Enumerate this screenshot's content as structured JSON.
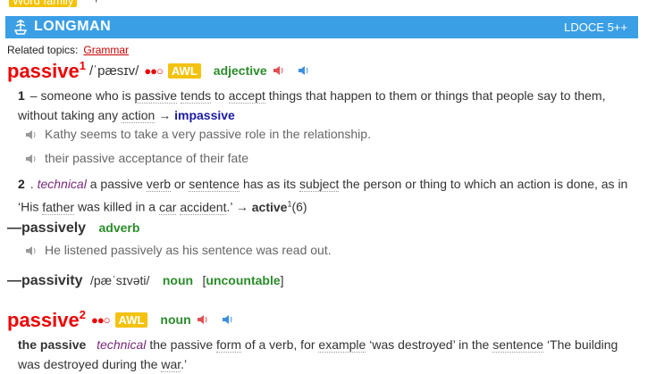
{
  "top": {
    "word_family": "Word family",
    "plus": "+"
  },
  "banner": {
    "brand": "LONGMAN",
    "edition": "LDOCE 5++"
  },
  "related": {
    "label": "Related topics:",
    "topic": "Grammar"
  },
  "entry1": {
    "headword": "passive",
    "homnum": "1",
    "pron": "/ˈpæsɪv/",
    "freq": "●●○",
    "awl": "AWL",
    "pos": "adjective",
    "sense1": {
      "num": "1",
      "sep": "–",
      "def_parts": [
        "someone who is",
        "passive",
        "tends",
        "to",
        "accept",
        "things that happen to them or things that people say to them, without taking any",
        "action",
        "→",
        "impassive"
      ],
      "examples": [
        "Kathy seems to take a very passive role in the relationship.",
        "their passive acceptance of their fate"
      ]
    },
    "sense2": {
      "num": "2",
      "dot": ".",
      "register": "technical",
      "text_a": "a passive",
      "verb": "verb",
      "or": "or",
      "sentence": "sentence",
      "has_as_its": "has as its",
      "subject": "subject",
      "rest": "the person or thing to which an action is done, as in ‘His",
      "father": "father",
      "was_killed": "was killed in a",
      "car": "car",
      "accident": "accident",
      "end": ".’",
      "arrow": "→",
      "xref": "active",
      "xref_sup": "1",
      "xref_num": "(6)"
    }
  },
  "runon1": {
    "dash": "—",
    "word": "passively",
    "pos": "adverb",
    "example": "He listened passively as his sentence was read out."
  },
  "runon2": {
    "dash": "—",
    "word": "passivity",
    "pron": "/pæˈsɪvəti/",
    "pos": "noun",
    "gram_open": "[",
    "gram": "uncountable",
    "gram_close": "]"
  },
  "entry2": {
    "headword": "passive",
    "homnum": "2",
    "freq": "●●○",
    "awl": "AWL",
    "pos": "noun",
    "sense": {
      "phrase": "the passive",
      "register": "technical",
      "text_a": "the passive",
      "form": "form",
      "of_a_verb": "of a verb, for",
      "example": "example",
      "quote": "‘was destroyed’ in the",
      "sentence": "sentence",
      "quote2": "‘The building was destroyed during the",
      "war": "war",
      "end": ".’"
    }
  },
  "colors": {
    "banner": "#3b9fe6",
    "headword": "#e00000",
    "awl": "#f4c20d",
    "pos": "#2a8c2a",
    "xref": "#1a1aa6"
  }
}
